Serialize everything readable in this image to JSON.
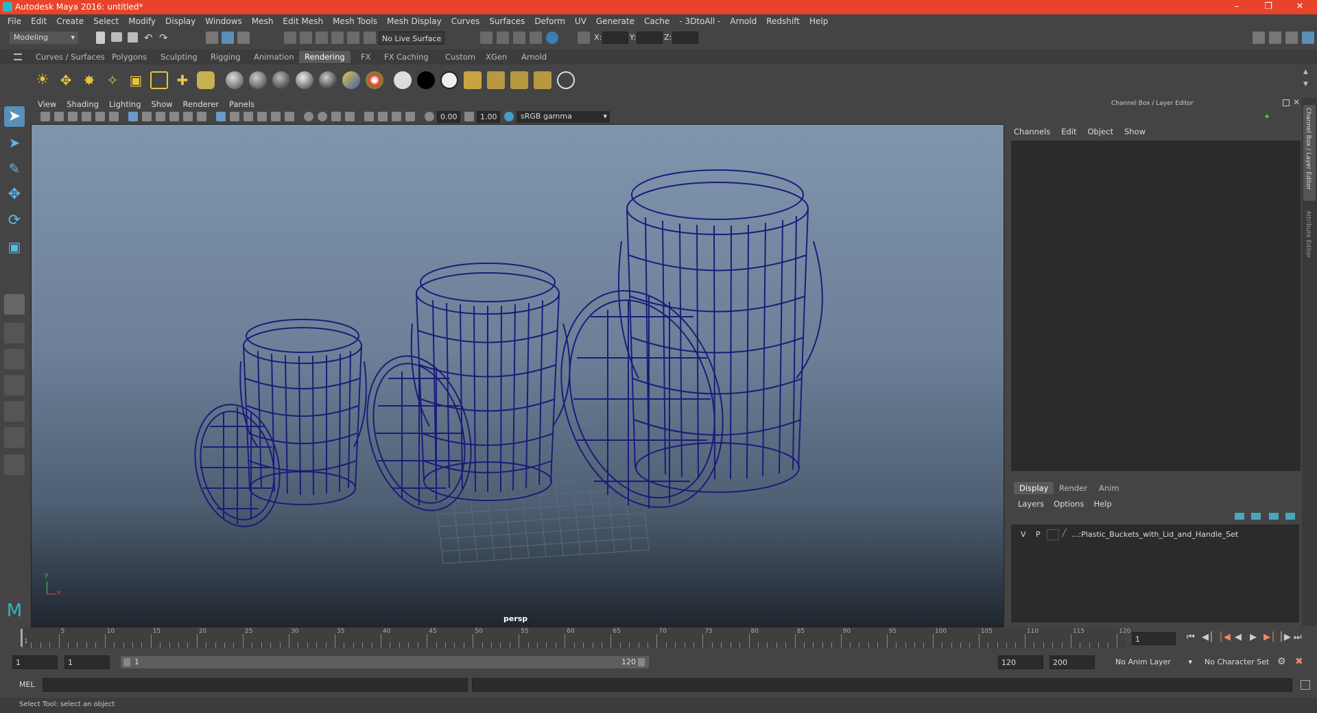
{
  "title": "Autodesk Maya 2016: untitled*",
  "menus": [
    "File",
    "Edit",
    "Create",
    "Select",
    "Modify",
    "Display",
    "Windows",
    "Mesh",
    "Edit Mesh",
    "Mesh Tools",
    "Mesh Display",
    "Curves",
    "Surfaces",
    "Deform",
    "UV",
    "Generate",
    "Cache",
    "- 3DtoAll -",
    "Arnold",
    "Redshift",
    "Help"
  ],
  "status": {
    "mode": "Modeling",
    "live_surface": "No Live Surface",
    "x_label": "X:",
    "y_label": "Y:",
    "z_label": "Z:"
  },
  "shelf_tabs": [
    "Curves / Surfaces",
    "Polygons",
    "Sculpting",
    "Rigging",
    "Animation",
    "Rendering",
    "FX",
    "FX Caching",
    "Custom",
    "XGen",
    "Arnold"
  ],
  "active_shelf_tab": "Rendering",
  "viewport": {
    "menus": [
      "View",
      "Shading",
      "Lighting",
      "Show",
      "Renderer",
      "Panels"
    ],
    "exposure": "0.00",
    "gamma": "1.00",
    "color_space": "sRGB gamma",
    "camera_label": "persp",
    "axis_y": "y",
    "axis_x": "x"
  },
  "channel_box": {
    "header": "Channel Box / Layer Editor",
    "menus": [
      "Channels",
      "Edit",
      "Object",
      "Show"
    ]
  },
  "layer_editor": {
    "tabs": [
      "Display",
      "Render",
      "Anim"
    ],
    "active_tab": "Display",
    "menus": [
      "Layers",
      "Options",
      "Help"
    ],
    "layers": [
      {
        "v": "V",
        "p": "P",
        "name": "...:Plastic_Buckets_with_Lid_and_Handle_Set"
      }
    ]
  },
  "side_tabs": [
    "Channel Box / Layer Editor",
    "Attribute Editor"
  ],
  "timeline": {
    "ticks": [
      "1",
      "5",
      "10",
      "15",
      "20",
      "25",
      "30",
      "35",
      "40",
      "45",
      "50",
      "55",
      "60",
      "65",
      "70",
      "75",
      "80",
      "85",
      "90",
      "95",
      "100",
      "105",
      "110",
      "115",
      "120"
    ],
    "current_frame": "1"
  },
  "range": {
    "start": "1",
    "anim_start": "1",
    "slider_start": "1",
    "slider_end": "120",
    "anim_end": "120",
    "end": "200",
    "anim_layer": "No Anim Layer",
    "character_set": "No Character Set"
  },
  "command_line": {
    "label": "MEL"
  },
  "help_line": "Select Tool: select an object"
}
